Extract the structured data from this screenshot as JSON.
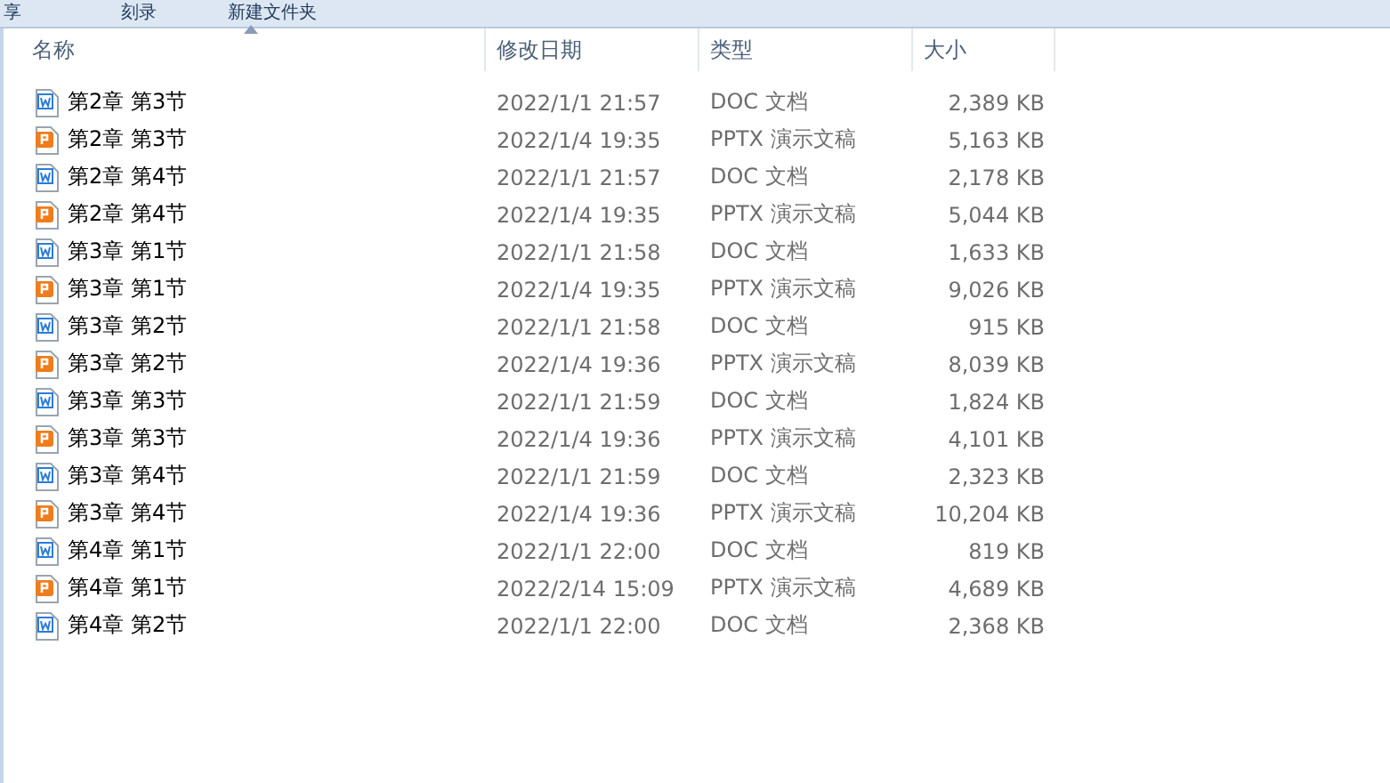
{
  "toolbar": {
    "items": [
      {
        "label": "享"
      },
      {
        "label": "刻录"
      },
      {
        "label": "新建文件夹"
      }
    ]
  },
  "table": {
    "columns": [
      {
        "label": "名称",
        "sorted": true
      },
      {
        "label": "修改日期",
        "sorted": false
      },
      {
        "label": "类型",
        "sorted": false
      },
      {
        "label": "大小",
        "sorted": false
      }
    ],
    "rows": [
      {
        "kind": "doc",
        "name": "第2章 第3节",
        "date": "2022/1/1 21:57",
        "type": "DOC 文档",
        "size": "2,389 KB"
      },
      {
        "kind": "pptx",
        "name": "第2章 第3节",
        "date": "2022/1/4 19:35",
        "type": "PPTX 演示文稿",
        "size": "5,163 KB"
      },
      {
        "kind": "doc",
        "name": "第2章 第4节",
        "date": "2022/1/1 21:57",
        "type": "DOC 文档",
        "size": "2,178 KB"
      },
      {
        "kind": "pptx",
        "name": "第2章 第4节",
        "date": "2022/1/4 19:35",
        "type": "PPTX 演示文稿",
        "size": "5,044 KB"
      },
      {
        "kind": "doc",
        "name": "第3章 第1节",
        "date": "2022/1/1 21:58",
        "type": "DOC 文档",
        "size": "1,633 KB"
      },
      {
        "kind": "pptx",
        "name": "第3章 第1节",
        "date": "2022/1/4 19:35",
        "type": "PPTX 演示文稿",
        "size": "9,026 KB"
      },
      {
        "kind": "doc",
        "name": "第3章 第2节",
        "date": "2022/1/1 21:58",
        "type": "DOC 文档",
        "size": "915 KB"
      },
      {
        "kind": "pptx",
        "name": "第3章 第2节",
        "date": "2022/1/4 19:36",
        "type": "PPTX 演示文稿",
        "size": "8,039 KB"
      },
      {
        "kind": "doc",
        "name": "第3章 第3节",
        "date": "2022/1/1 21:59",
        "type": "DOC 文档",
        "size": "1,824 KB"
      },
      {
        "kind": "pptx",
        "name": "第3章 第3节",
        "date": "2022/1/4 19:36",
        "type": "PPTX 演示文稿",
        "size": "4,101 KB"
      },
      {
        "kind": "doc",
        "name": "第3章 第4节",
        "date": "2022/1/1 21:59",
        "type": "DOC 文档",
        "size": "2,323 KB"
      },
      {
        "kind": "pptx",
        "name": "第3章 第4节",
        "date": "2022/1/4 19:36",
        "type": "PPTX 演示文稿",
        "size": "10,204 KB"
      },
      {
        "kind": "doc",
        "name": "第4章 第1节",
        "date": "2022/1/1 22:00",
        "type": "DOC 文档",
        "size": "819 KB"
      },
      {
        "kind": "pptx",
        "name": "第4章 第1节",
        "date": "2022/2/14 15:09",
        "type": "PPTX 演示文稿",
        "size": "4,689 KB"
      },
      {
        "kind": "doc",
        "name": "第4章 第2节",
        "date": "2022/1/1 22:00",
        "type": "DOC 文档",
        "size": "2,368 KB"
      }
    ]
  }
}
